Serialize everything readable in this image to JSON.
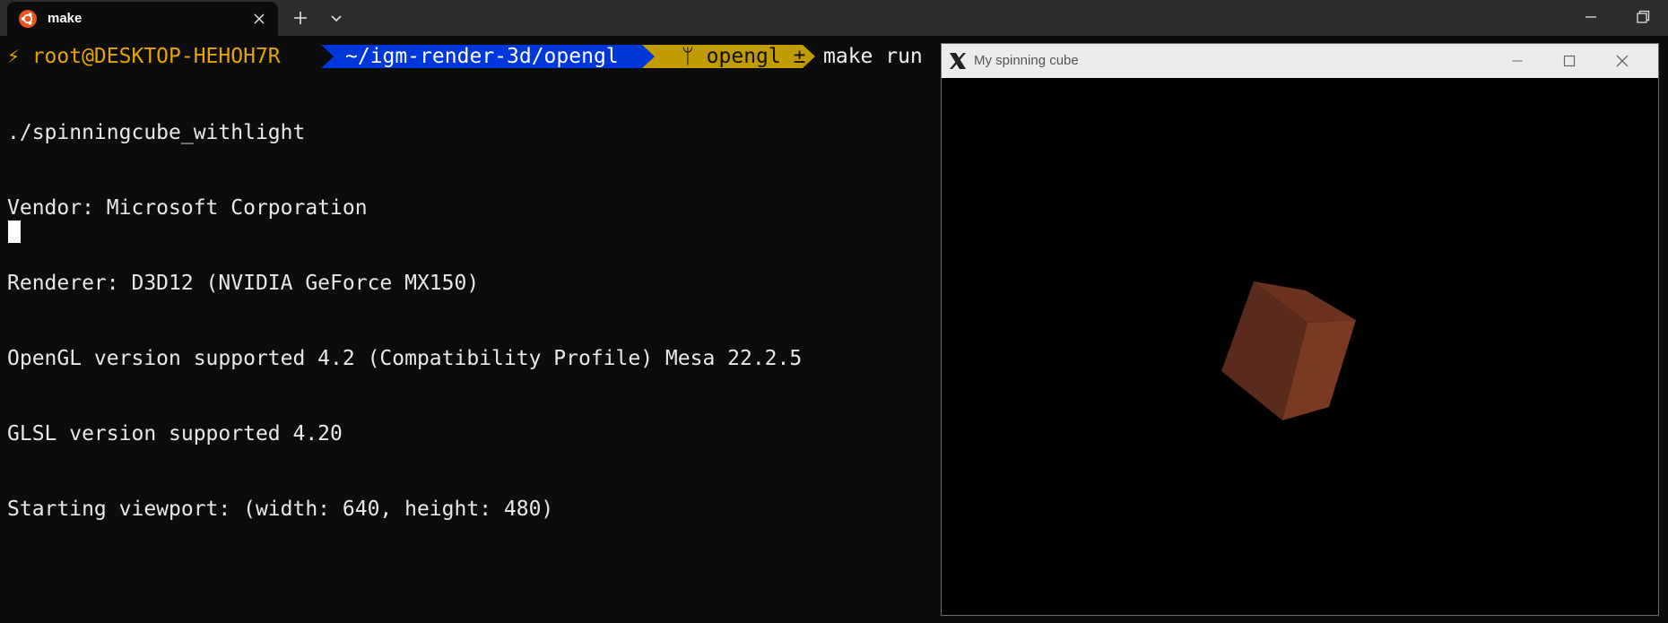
{
  "tab": {
    "title": "make",
    "icon": "ubuntu-icon"
  },
  "prompt": {
    "user": "⚡ root@DESKTOP-HEHOH7R",
    "path": "~/igm-render-3d/opengl",
    "git": "ᛘ opengl ±",
    "command": "make run"
  },
  "output": [
    "./spinningcube_withlight",
    "Vendor: Microsoft Corporation",
    "Renderer: D3D12 (NVIDIA GeForce MX150)",
    "OpenGL version supported 4.2 (Compatibility Profile) Mesa 22.2.5",
    "GLSL version supported 4.20",
    "Starting viewport: (width: 640, height: 480)"
  ],
  "xwindow": {
    "title": "My spinning cube",
    "icon": "x-logo-icon"
  },
  "colors": {
    "path_segment": "#0037da",
    "git_segment": "#c19c00",
    "prompt_user": "#e6a400",
    "cube_left_face": "#5a2a1c",
    "cube_right_face": "#7a3a22",
    "cube_top_face": "#6b3220"
  }
}
